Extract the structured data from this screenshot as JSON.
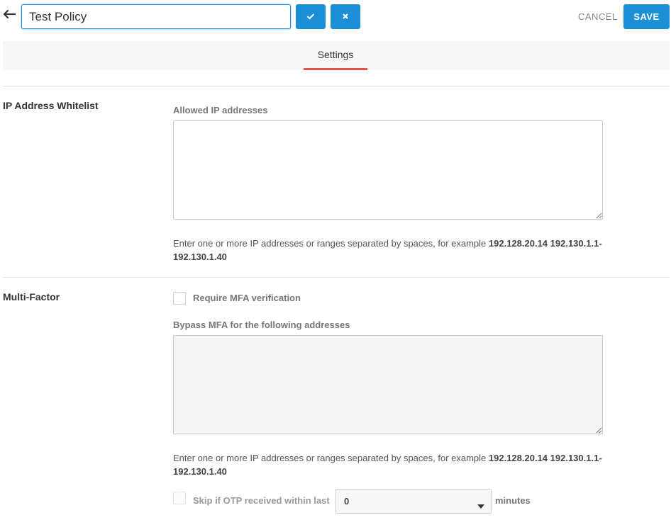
{
  "header": {
    "policy_name": "Test Policy",
    "cancel_label": "CANCEL",
    "save_label": "SAVE"
  },
  "tabs": [
    {
      "label": "Settings",
      "active": true
    }
  ],
  "ip_whitelist": {
    "section_title": "IP Address Whitelist",
    "field_label": "Allowed IP addresses",
    "value": "",
    "help_prefix": "Enter one or more IP addresses or ranges separated by spaces, for example ",
    "help_example_line1": "192.128.20.14 192.130.1.1-",
    "help_example_line2": "192.130.1.40"
  },
  "multi_factor": {
    "section_title": "Multi-Factor",
    "require_label": "Require MFA verification",
    "require_checked": false,
    "bypass_label": "Bypass MFA for the following addresses",
    "bypass_value": "",
    "help_prefix": "Enter one or more IP addresses or ranges separated by spaces, for example ",
    "help_example_line1": "192.128.20.14 192.130.1.1-",
    "help_example_line2": "192.130.1.40",
    "skip_label": "Skip if OTP received within last",
    "skip_checked": false,
    "skip_value": "0",
    "minutes_label": "minutes"
  },
  "colors": {
    "primary": "#1b8ed6",
    "tab_indicator": "#e0524f"
  }
}
